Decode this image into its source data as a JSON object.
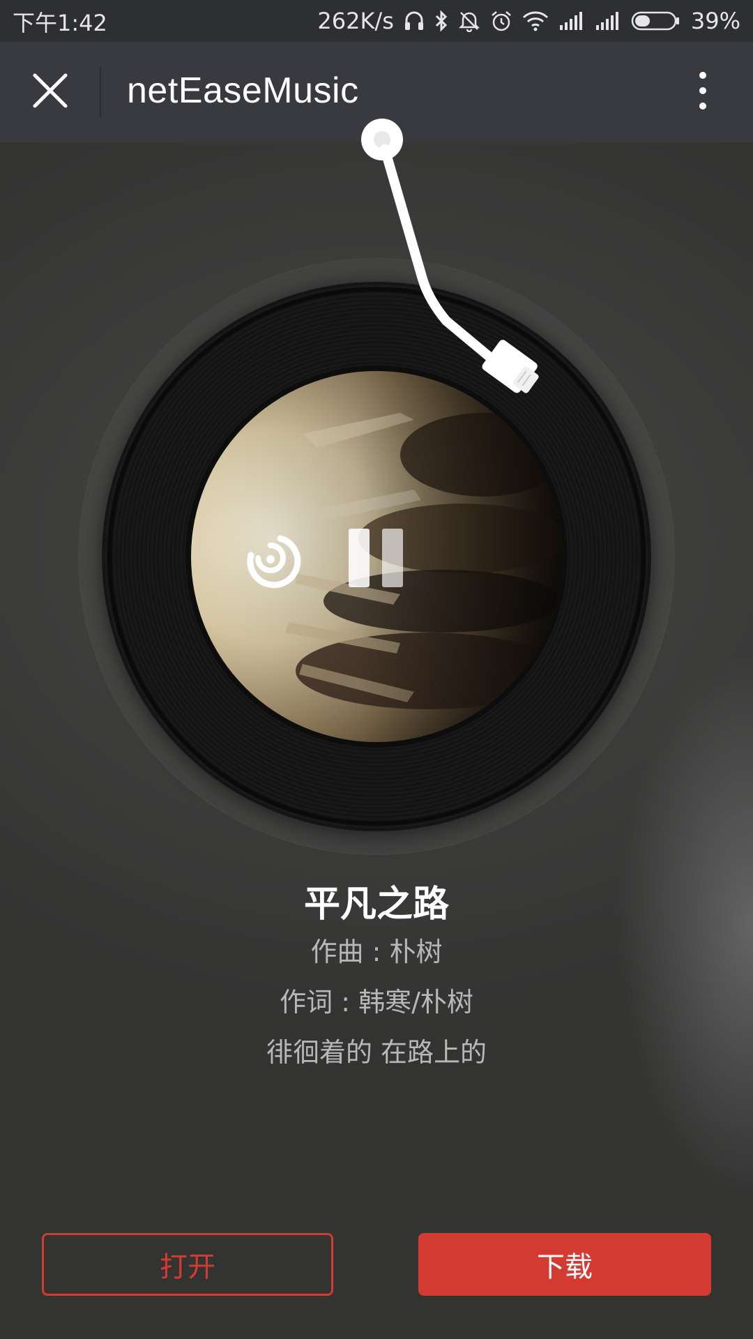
{
  "status_bar": {
    "time": "下午1:42",
    "network_speed": "262K/s",
    "battery_percent": "39%",
    "battery_level": 0.39,
    "icons": [
      "headset-icon",
      "bluetooth-icon",
      "mute-icon",
      "alarm-icon",
      "wifi-icon",
      "signal-icon",
      "signal-icon",
      "battery-icon"
    ]
  },
  "app_bar": {
    "title": "netEaseMusic",
    "close_icon": "close-icon",
    "more_icon": "more-vertical-icon"
  },
  "player": {
    "controls": [
      "replay-icon",
      "pause-icon"
    ]
  },
  "song": {
    "title": "平凡之路",
    "composer": "作曲 : 朴树",
    "lyricist": "作词 : 韩寒/朴树",
    "lyric_line": "徘徊着的 在路上的"
  },
  "actions": {
    "open_label": "打开",
    "download_label": "下载"
  },
  "colors": {
    "accent": "#d33a32",
    "app_bar": "#393a3f",
    "status_bar": "#2e2f33"
  }
}
